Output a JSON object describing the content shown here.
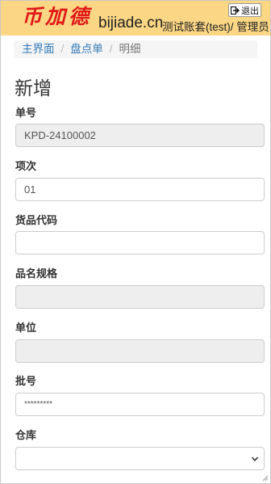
{
  "header": {
    "logo_cn": "币加德",
    "logo_en": "bijiade.cn",
    "user_info": "测试账套(test)/ 管理员",
    "logout_label": "退出"
  },
  "breadcrumb": {
    "items": [
      "主界面",
      "盘点单"
    ],
    "current": "明细"
  },
  "page": {
    "title": "新增"
  },
  "form": {
    "order_no": {
      "label": "单号",
      "value": "KPD-24100002"
    },
    "item_no": {
      "label": "项次",
      "value": "01"
    },
    "product_code": {
      "label": "货品代码",
      "value": ""
    },
    "product_spec": {
      "label": "品名规格",
      "value": ""
    },
    "unit": {
      "label": "单位",
      "value": ""
    },
    "batch_no": {
      "label": "批号",
      "value": "*********"
    },
    "warehouse": {
      "label": "仓库",
      "value": ""
    }
  },
  "colors": {
    "header_bg": "#fbd684",
    "logo_red": "#e01818",
    "link_blue": "#337ab7",
    "readonly_bg": "#eeeeee"
  },
  "icons": [
    "logout-icon",
    "chevron-down-icon",
    "resize-grip-icon"
  ]
}
